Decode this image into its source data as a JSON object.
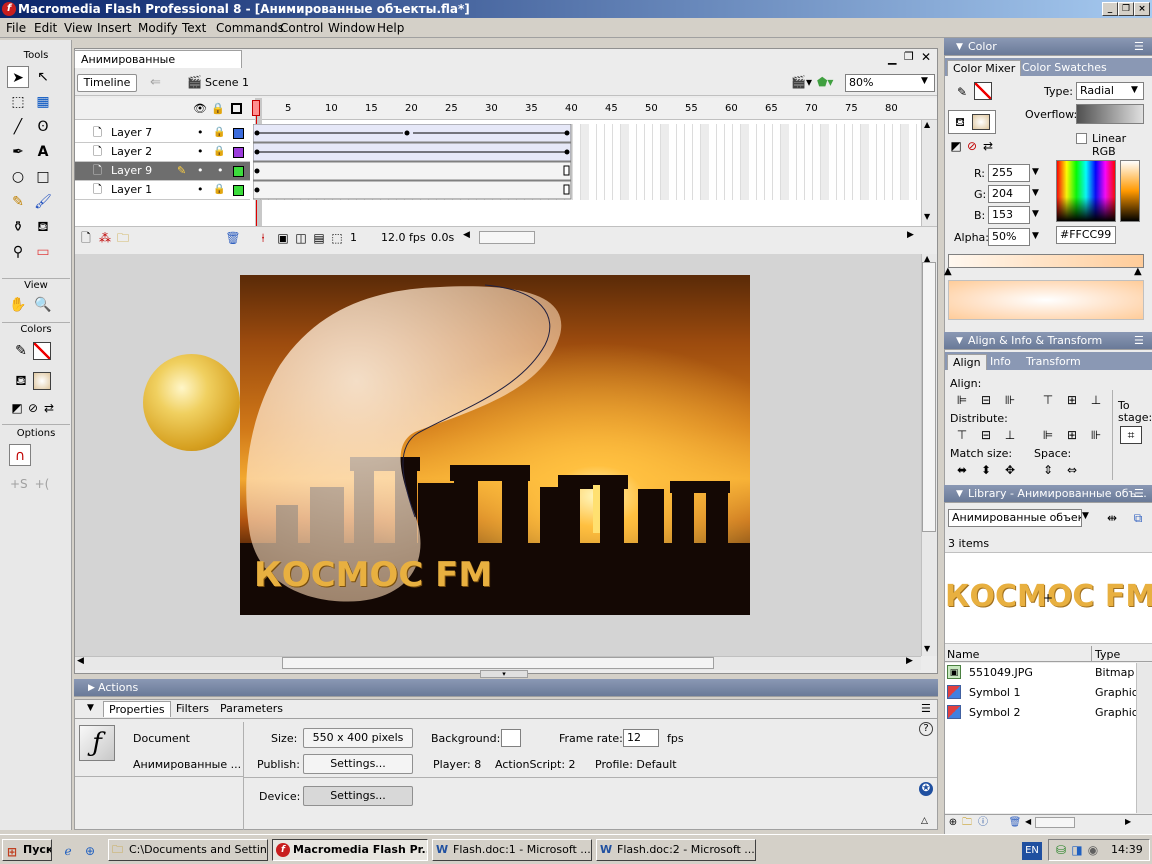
{
  "window": {
    "title": "Macromedia Flash Professional 8 - [Анимированные объекты.fla*]"
  },
  "menu": [
    "File",
    "Edit",
    "View",
    "Insert",
    "Modify",
    "Text",
    "Commands",
    "Control",
    "Window",
    "Help"
  ],
  "tools": {
    "header": "Tools",
    "view_header": "View",
    "colors_header": "Colors",
    "options_header": "Options"
  },
  "document": {
    "tab": "Анимированные объекты.fla*",
    "timeline_button": "Timeline",
    "scene": "Scene 1",
    "zoom": "80%"
  },
  "timeline": {
    "ruler": [
      "1",
      "5",
      "10",
      "15",
      "20",
      "25",
      "30",
      "35",
      "40",
      "45",
      "50",
      "55",
      "60",
      "65",
      "70",
      "75",
      "80"
    ],
    "layers": [
      {
        "name": "Layer 7",
        "color": "#3c6cdc"
      },
      {
        "name": "Layer 2",
        "color": "#9c3cdc"
      },
      {
        "name": "Layer 9",
        "color": "#3cdc3c"
      },
      {
        "name": "Layer 1",
        "color": "#3cdc3c"
      }
    ],
    "current_frame": "1",
    "fps": "12.0 fps",
    "elapsed": "0.0s"
  },
  "stage": {
    "text": "КОСМОС FM"
  },
  "actions": {
    "label": "Actions"
  },
  "properties": {
    "tabs": [
      "Properties",
      "Filters",
      "Parameters"
    ],
    "doc_label": "Document",
    "doc_name": "Анимированные ...",
    "size_label": "Size:",
    "size_value": "550 x 400 pixels",
    "background_label": "Background:",
    "framerate_label": "Frame rate:",
    "framerate_value": "12",
    "fps_unit": "fps",
    "publish_label": "Publish:",
    "settings_button": "Settings...",
    "player": "Player: 8",
    "actionscript": "ActionScript:  2",
    "profile": "Profile:  Default",
    "device_label": "Device:"
  },
  "color_panel": {
    "title": "Color",
    "tabs": [
      "Color Mixer",
      "Color Swatches"
    ],
    "type_label": "Type:",
    "type_value": "Radial",
    "overflow_label": "Overflow:",
    "linear_rgb": "Linear RGB",
    "r_label": "R:",
    "r_value": "255",
    "g_label": "G:",
    "g_value": "204",
    "b_label": "B:",
    "b_value": "153",
    "alpha_label": "Alpha:",
    "alpha_value": "50%",
    "hex": "#FFCC99",
    "swatch_color": "#ffcc99"
  },
  "align_panel": {
    "title": "Align & Info & Transform",
    "tabs": [
      "Align",
      "Info",
      "Transform"
    ],
    "align_label": "Align:",
    "distribute_label": "Distribute:",
    "match_label": "Match size:",
    "space_label": "Space:",
    "to_stage": "To stage:"
  },
  "library": {
    "title": "Library - Анимированные объ...",
    "selector": "Анимированные объекть",
    "count": "3 items",
    "preview_text": "КОСМОС FM",
    "col_name": "Name",
    "col_type": "Type",
    "items": [
      {
        "name": "551049.JPG",
        "type": "Bitmap"
      },
      {
        "name": "Symbol 1",
        "type": "Graphic"
      },
      {
        "name": "Symbol 2",
        "type": "Graphic"
      }
    ]
  },
  "taskbar": {
    "start": "Пуск",
    "tasks": [
      "C:\\Documents and Settin...",
      "Macromedia Flash Pr...",
      "Flash.doc:1 - Microsoft ...",
      "Flash.doc:2 - Microsoft ..."
    ],
    "lang": "EN",
    "time": "14:39"
  }
}
